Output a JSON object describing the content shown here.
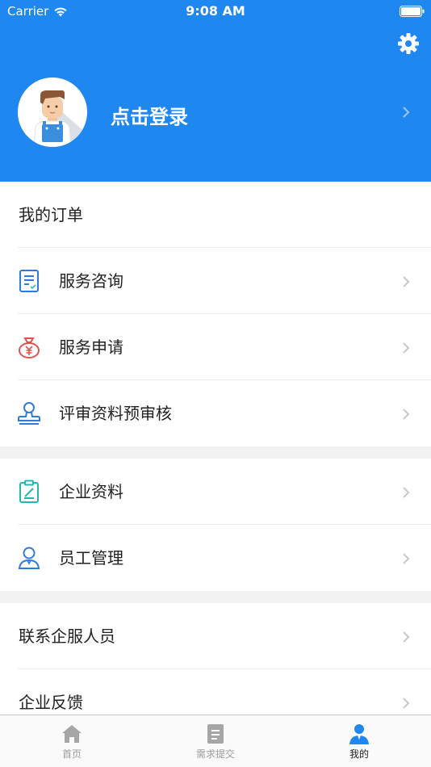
{
  "status_bar": {
    "carrier": "Carrier",
    "time": "9:08 AM"
  },
  "header": {
    "login_label": "点击登录",
    "settings_icon": "gear-icon",
    "background_color": "#1f87f0"
  },
  "menu": {
    "orders_heading": "我的订单",
    "service_consult": "服务咨询",
    "service_apply": "服务申请",
    "review_precheck": "评审资料预审核",
    "company_profile": "企业资料",
    "staff_management": "员工管理",
    "contact_staff": "联系企服人员",
    "company_feedback": "企业反馈"
  },
  "tabbar": {
    "home": "首页",
    "submit_request": "需求提交",
    "mine": "我的",
    "active_tab": "mine",
    "active_color": "#1f87f0",
    "inactive_color": "#9b9b9b"
  }
}
